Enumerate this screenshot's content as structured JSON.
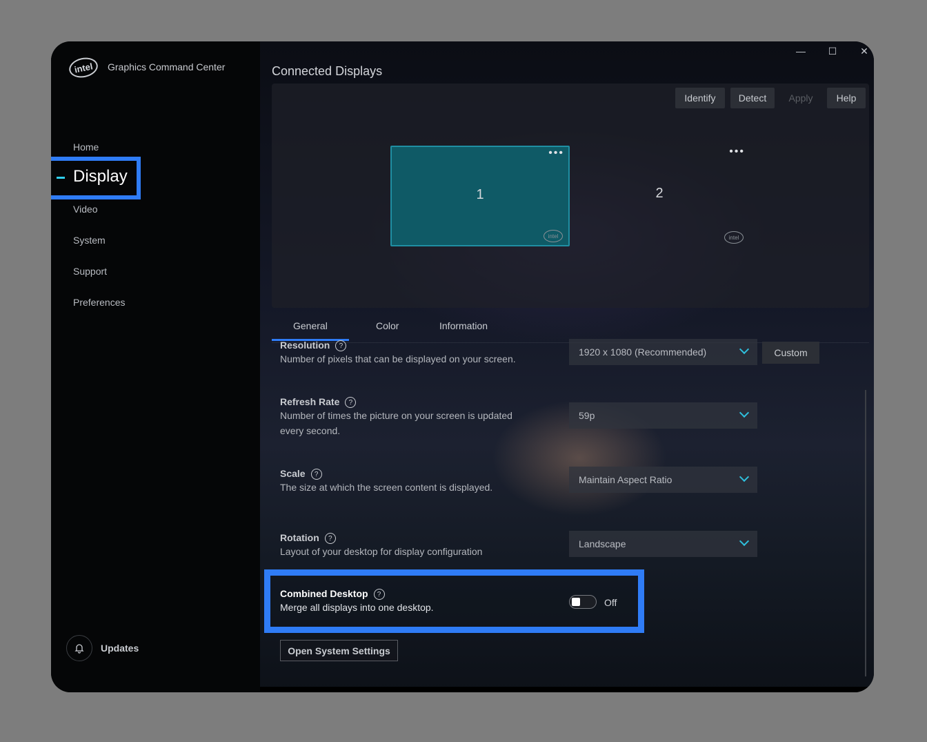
{
  "app": {
    "title": "Graphics Command Center",
    "logo_text": "intel"
  },
  "sidebar": {
    "items": [
      {
        "label": "Home"
      },
      {
        "label": "Display",
        "active": true
      },
      {
        "label": "Video"
      },
      {
        "label": "System"
      },
      {
        "label": "Support"
      },
      {
        "label": "Preferences"
      }
    ],
    "updates_label": "Updates"
  },
  "window_controls": {
    "minimize": "—",
    "maximize": "☐",
    "close": "✕"
  },
  "main": {
    "section_title": "Connected Displays",
    "toolbar": {
      "identify": "Identify",
      "detect": "Detect",
      "apply": "Apply",
      "help": "Help"
    },
    "monitors": [
      {
        "number": "1",
        "selected": true,
        "menu": "•••",
        "brand": "intel"
      },
      {
        "number": "2",
        "selected": false,
        "menu": "•••",
        "brand": "intel"
      }
    ],
    "tabs": [
      {
        "label": "General",
        "active": true
      },
      {
        "label": "Color"
      },
      {
        "label": "Information"
      }
    ],
    "settings": {
      "resolution": {
        "label": "Resolution",
        "desc": "Number of pixels that can be displayed on your screen.",
        "value": "1920 x 1080 (Recommended)",
        "custom_label": "Custom"
      },
      "refresh_rate": {
        "label": "Refresh Rate",
        "desc": "Number of times the picture on your screen is updated every second.",
        "value": "59p"
      },
      "scale": {
        "label": "Scale",
        "desc": "The size at which the screen content is displayed.",
        "value": "Maintain Aspect Ratio"
      },
      "rotation": {
        "label": "Rotation",
        "desc": "Layout of your desktop for display configuration",
        "value": "Landscape"
      },
      "combined_desktop": {
        "label": "Combined Desktop",
        "desc": "Merge all displays into one desktop.",
        "state": "Off"
      }
    },
    "open_system_settings": "Open System Settings"
  },
  "colors": {
    "accent_blue": "#2f7cf6",
    "active_indicator": "#2fd0f0",
    "monitor_selected": "#0f5a66"
  }
}
